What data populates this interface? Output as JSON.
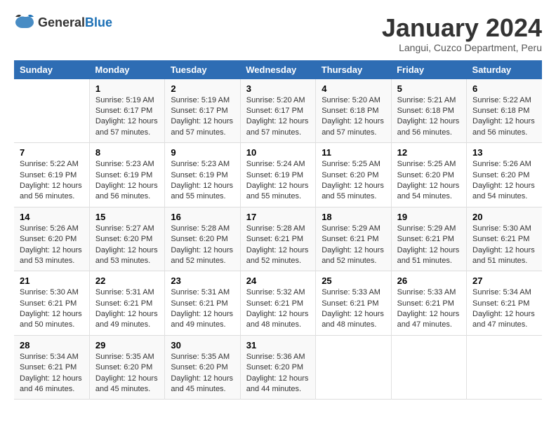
{
  "logo": {
    "text_general": "General",
    "text_blue": "Blue"
  },
  "title": "January 2024",
  "subtitle": "Langui, Cuzco Department, Peru",
  "weekdays": [
    "Sunday",
    "Monday",
    "Tuesday",
    "Wednesday",
    "Thursday",
    "Friday",
    "Saturday"
  ],
  "weeks": [
    [
      {
        "day": "",
        "info": ""
      },
      {
        "day": "1",
        "info": "Sunrise: 5:19 AM\nSunset: 6:17 PM\nDaylight: 12 hours\nand 57 minutes."
      },
      {
        "day": "2",
        "info": "Sunrise: 5:19 AM\nSunset: 6:17 PM\nDaylight: 12 hours\nand 57 minutes."
      },
      {
        "day": "3",
        "info": "Sunrise: 5:20 AM\nSunset: 6:17 PM\nDaylight: 12 hours\nand 57 minutes."
      },
      {
        "day": "4",
        "info": "Sunrise: 5:20 AM\nSunset: 6:18 PM\nDaylight: 12 hours\nand 57 minutes."
      },
      {
        "day": "5",
        "info": "Sunrise: 5:21 AM\nSunset: 6:18 PM\nDaylight: 12 hours\nand 56 minutes."
      },
      {
        "day": "6",
        "info": "Sunrise: 5:22 AM\nSunset: 6:18 PM\nDaylight: 12 hours\nand 56 minutes."
      }
    ],
    [
      {
        "day": "7",
        "info": "Sunrise: 5:22 AM\nSunset: 6:19 PM\nDaylight: 12 hours\nand 56 minutes."
      },
      {
        "day": "8",
        "info": "Sunrise: 5:23 AM\nSunset: 6:19 PM\nDaylight: 12 hours\nand 56 minutes."
      },
      {
        "day": "9",
        "info": "Sunrise: 5:23 AM\nSunset: 6:19 PM\nDaylight: 12 hours\nand 55 minutes."
      },
      {
        "day": "10",
        "info": "Sunrise: 5:24 AM\nSunset: 6:19 PM\nDaylight: 12 hours\nand 55 minutes."
      },
      {
        "day": "11",
        "info": "Sunrise: 5:25 AM\nSunset: 6:20 PM\nDaylight: 12 hours\nand 55 minutes."
      },
      {
        "day": "12",
        "info": "Sunrise: 5:25 AM\nSunset: 6:20 PM\nDaylight: 12 hours\nand 54 minutes."
      },
      {
        "day": "13",
        "info": "Sunrise: 5:26 AM\nSunset: 6:20 PM\nDaylight: 12 hours\nand 54 minutes."
      }
    ],
    [
      {
        "day": "14",
        "info": "Sunrise: 5:26 AM\nSunset: 6:20 PM\nDaylight: 12 hours\nand 53 minutes."
      },
      {
        "day": "15",
        "info": "Sunrise: 5:27 AM\nSunset: 6:20 PM\nDaylight: 12 hours\nand 53 minutes."
      },
      {
        "day": "16",
        "info": "Sunrise: 5:28 AM\nSunset: 6:20 PM\nDaylight: 12 hours\nand 52 minutes."
      },
      {
        "day": "17",
        "info": "Sunrise: 5:28 AM\nSunset: 6:21 PM\nDaylight: 12 hours\nand 52 minutes."
      },
      {
        "day": "18",
        "info": "Sunrise: 5:29 AM\nSunset: 6:21 PM\nDaylight: 12 hours\nand 52 minutes."
      },
      {
        "day": "19",
        "info": "Sunrise: 5:29 AM\nSunset: 6:21 PM\nDaylight: 12 hours\nand 51 minutes."
      },
      {
        "day": "20",
        "info": "Sunrise: 5:30 AM\nSunset: 6:21 PM\nDaylight: 12 hours\nand 51 minutes."
      }
    ],
    [
      {
        "day": "21",
        "info": "Sunrise: 5:30 AM\nSunset: 6:21 PM\nDaylight: 12 hours\nand 50 minutes."
      },
      {
        "day": "22",
        "info": "Sunrise: 5:31 AM\nSunset: 6:21 PM\nDaylight: 12 hours\nand 49 minutes."
      },
      {
        "day": "23",
        "info": "Sunrise: 5:31 AM\nSunset: 6:21 PM\nDaylight: 12 hours\nand 49 minutes."
      },
      {
        "day": "24",
        "info": "Sunrise: 5:32 AM\nSunset: 6:21 PM\nDaylight: 12 hours\nand 48 minutes."
      },
      {
        "day": "25",
        "info": "Sunrise: 5:33 AM\nSunset: 6:21 PM\nDaylight: 12 hours\nand 48 minutes."
      },
      {
        "day": "26",
        "info": "Sunrise: 5:33 AM\nSunset: 6:21 PM\nDaylight: 12 hours\nand 47 minutes."
      },
      {
        "day": "27",
        "info": "Sunrise: 5:34 AM\nSunset: 6:21 PM\nDaylight: 12 hours\nand 47 minutes."
      }
    ],
    [
      {
        "day": "28",
        "info": "Sunrise: 5:34 AM\nSunset: 6:21 PM\nDaylight: 12 hours\nand 46 minutes."
      },
      {
        "day": "29",
        "info": "Sunrise: 5:35 AM\nSunset: 6:20 PM\nDaylight: 12 hours\nand 45 minutes."
      },
      {
        "day": "30",
        "info": "Sunrise: 5:35 AM\nSunset: 6:20 PM\nDaylight: 12 hours\nand 45 minutes."
      },
      {
        "day": "31",
        "info": "Sunrise: 5:36 AM\nSunset: 6:20 PM\nDaylight: 12 hours\nand 44 minutes."
      },
      {
        "day": "",
        "info": ""
      },
      {
        "day": "",
        "info": ""
      },
      {
        "day": "",
        "info": ""
      }
    ]
  ]
}
